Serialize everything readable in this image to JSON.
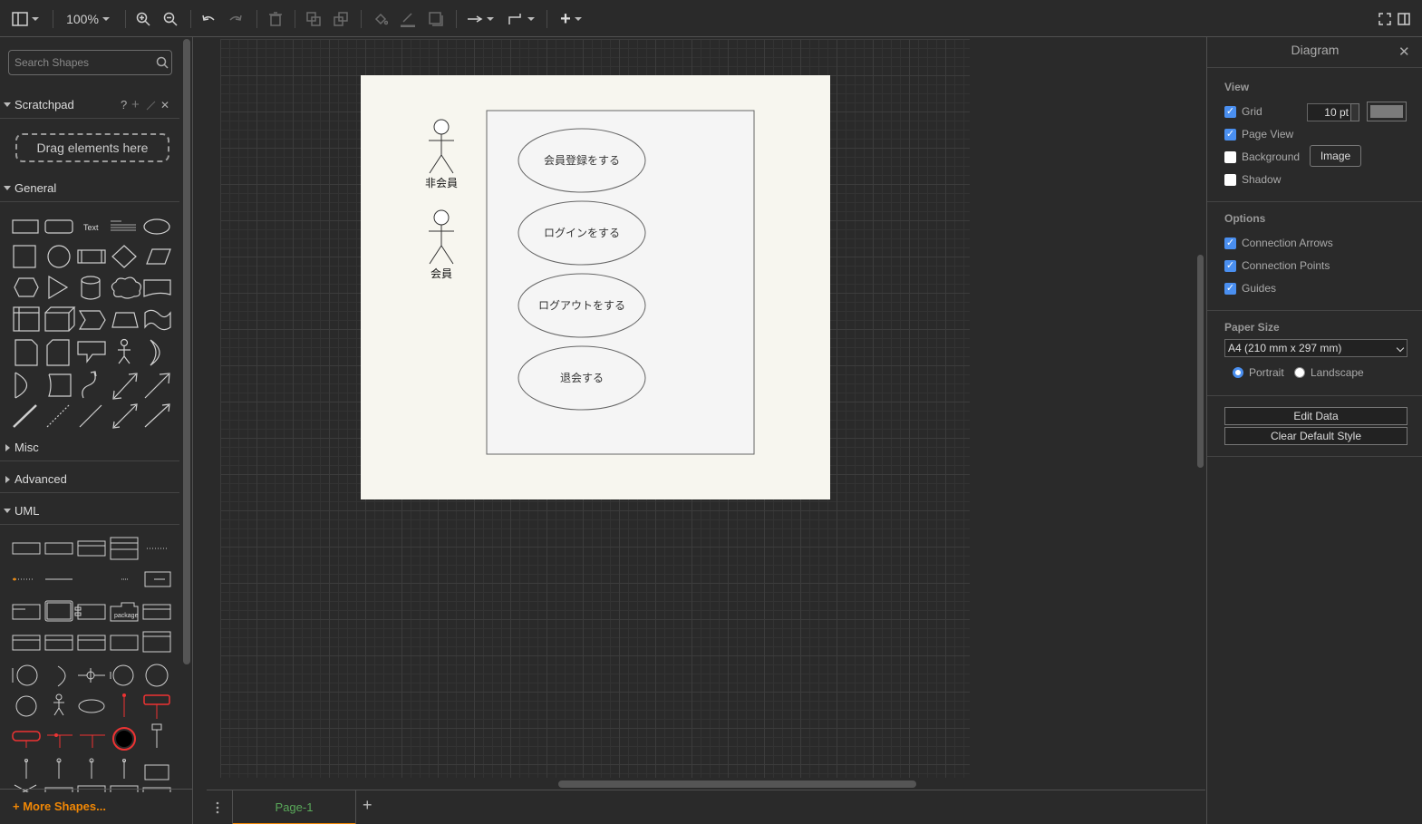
{
  "toolbar": {
    "zoom": "100%"
  },
  "sidebar": {
    "search_placeholder": "Search Shapes",
    "scratchpad": {
      "title": "Scratchpad",
      "help": "?",
      "add": "+",
      "close": "✕",
      "drop_hint": "Drag elements here"
    },
    "sections": {
      "general": "General",
      "misc": "Misc",
      "advanced": "Advanced",
      "uml": "UML"
    },
    "general_text_shape": "Text",
    "more_shapes": "More Shapes..."
  },
  "diagram": {
    "actors": [
      "非会員",
      "会員"
    ],
    "use_cases": [
      "会員登録をする",
      "ログインをする",
      "ログアウトをする",
      "退会する"
    ]
  },
  "pages": {
    "tab": "Page-1",
    "add": "+"
  },
  "panel": {
    "title": "Diagram",
    "close": "✕",
    "view": {
      "heading": "View",
      "grid": "Grid",
      "grid_checked": true,
      "grid_size": "10 pt",
      "page_view": "Page View",
      "page_view_checked": true,
      "background": "Background",
      "background_checked": false,
      "image_button": "Image",
      "shadow": "Shadow",
      "shadow_checked": false
    },
    "options": {
      "heading": "Options",
      "connection_arrows": "Connection Arrows",
      "connection_points": "Connection Points",
      "guides": "Guides"
    },
    "paper": {
      "heading": "Paper Size",
      "selected": "A4 (210 mm x 297 mm)",
      "portrait": "Portrait",
      "landscape": "Landscape",
      "orientation": "Portrait"
    },
    "buttons": {
      "edit_data": "Edit Data",
      "clear_default_style": "Clear Default Style"
    }
  },
  "colors": {
    "accent": "#f08705",
    "checkbox": "#4a8ff0",
    "tab_text": "#5aa95a",
    "grid_color": "#7b7b7b"
  }
}
